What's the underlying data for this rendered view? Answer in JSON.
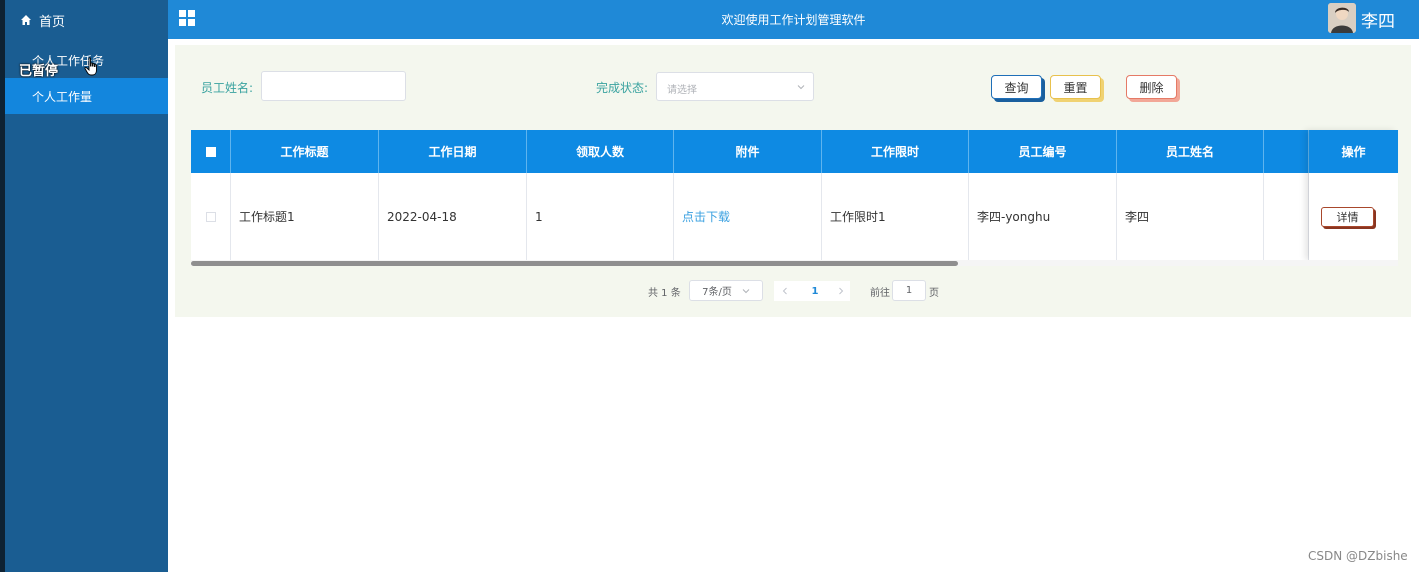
{
  "app": {
    "title": "欢迎使用工作计划管理软件",
    "user_name": "李四"
  },
  "sidebar": {
    "home_label": "首页",
    "items": [
      {
        "label": "个人工作任务"
      },
      {
        "label": "个人工作量"
      }
    ],
    "paused_overlay": "已暂停"
  },
  "search": {
    "employee_name_label": "员工姓名:",
    "employee_name_value": "",
    "status_label": "完成状态:",
    "status_placeholder": "请选择",
    "query_label": "查询",
    "reset_label": "重置",
    "delete_label": "删除"
  },
  "table": {
    "columns": [
      "工作标题",
      "工作日期",
      "领取人数",
      "附件",
      "工作限时",
      "员工编号",
      "员工姓名",
      "",
      "操作"
    ],
    "rows": [
      {
        "title": "工作标题1",
        "date": "2022-04-18",
        "count": "1",
        "attachment": "点击下载",
        "time_limit": "工作限时1",
        "employee_id": "李四-yonghu",
        "employee_name": "李四",
        "extra": "",
        "action": "详情"
      }
    ]
  },
  "pagination": {
    "total": "共 1 条",
    "page_size": "7条/页",
    "current_page": "1",
    "goto_label": "前往",
    "goto_value": "1",
    "page_suffix": "页"
  },
  "watermark": "CSDN @DZbishe",
  "colors": {
    "sidebar": "#1a5d92",
    "sidebar_active": "#1386dd",
    "topbar": "#1f89d7",
    "table_header": "#0e8ae3",
    "label_teal": "#3aa3a0"
  }
}
